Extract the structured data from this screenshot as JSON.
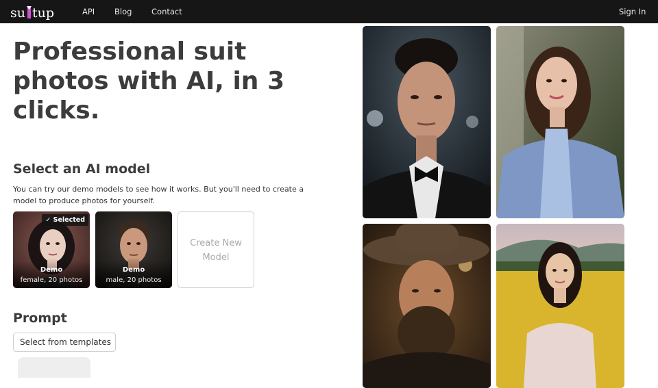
{
  "header": {
    "logo_text": "suitup",
    "nav": [
      {
        "label": "API"
      },
      {
        "label": "Blog"
      },
      {
        "label": "Contact"
      }
    ],
    "sign_in": "Sign In"
  },
  "hero": {
    "title": "Professional suit photos with AI, in 3 clicks."
  },
  "models_section": {
    "title": "Select an AI model",
    "description": "You can try our demo models to see how it works. But you'll need to create a model to produce photos for yourself.",
    "models": [
      {
        "name": "Demo",
        "detail": "female, 20 photos",
        "selected": true,
        "badge": "✓ Selected"
      },
      {
        "name": "Demo",
        "detail": "male, 20 photos",
        "selected": false
      }
    ],
    "create_label": "Create New Model"
  },
  "prompt_section": {
    "title": "Prompt",
    "template_button": "Select from templates"
  },
  "gallery": [
    {
      "subject": "man in black tuxedo with bow tie"
    },
    {
      "subject": "woman in light blue blazer"
    },
    {
      "subject": "bearded man in cowboy hat"
    },
    {
      "subject": "woman in floral dress in flower field"
    }
  ],
  "colors": {
    "header_bg": "#161616",
    "logo_accent": "#d04fd3",
    "heading": "#3c3c3c"
  }
}
